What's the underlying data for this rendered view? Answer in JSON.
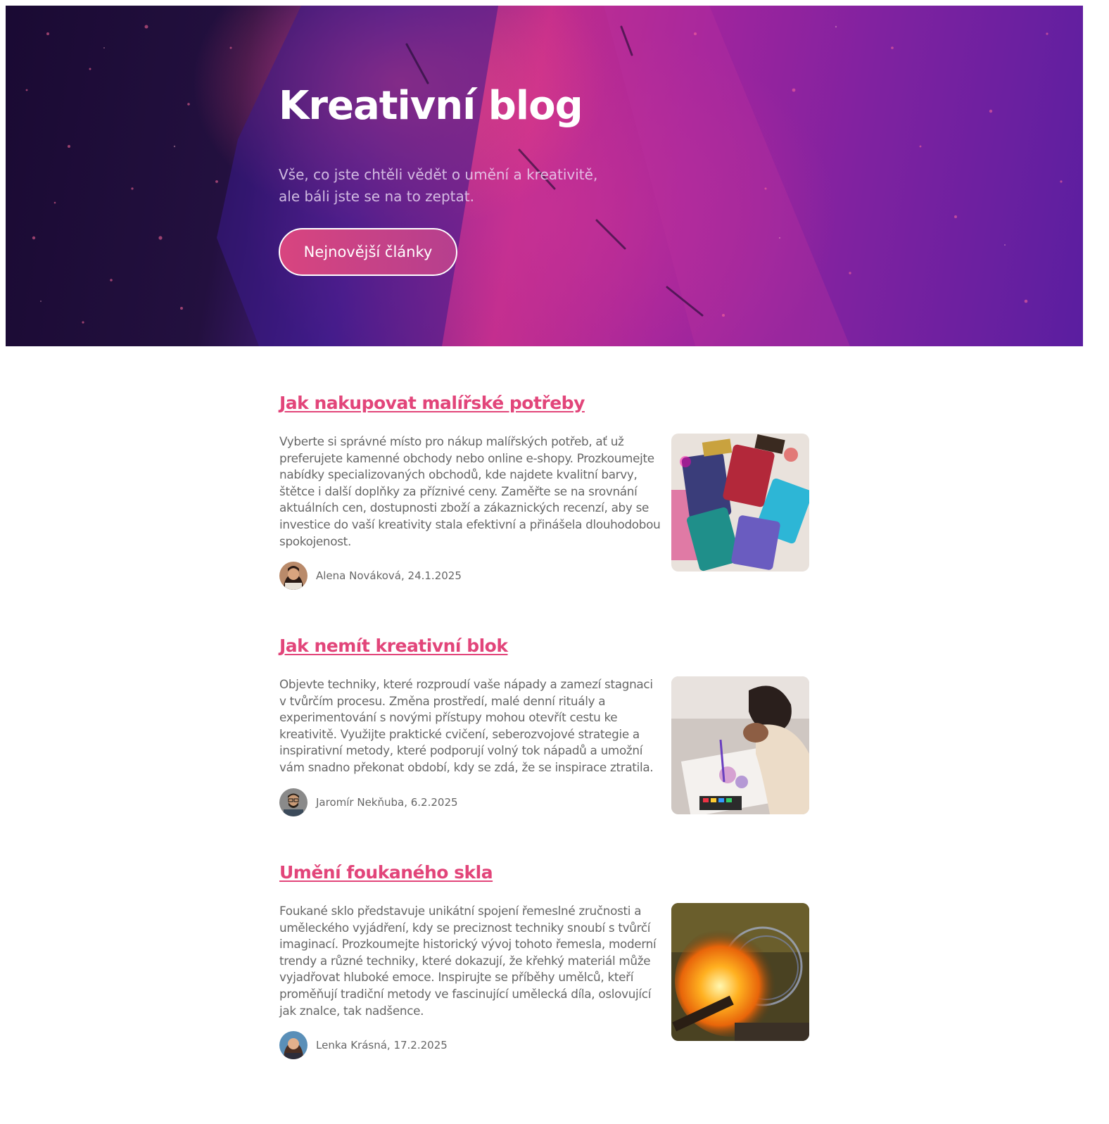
{
  "hero": {
    "title": "Kreativní blog",
    "subtitle": "Vše, co jste chtěli vědět o umění a kreativitě, ale báli jste se na to zeptat.",
    "cta_label": "Nejnovější články"
  },
  "articles": [
    {
      "title": "Jak nakupovat malířské potřeby",
      "text": "Vyberte si správné místo pro nákup malířských potřeb, ať už preferujete kamenné obchody nebo online e-shopy. Prozkoumejte nabídky specializovaných obchodů, kde najdete kvalitní barvy, štětce i další doplňky za příznivé ceny. Zaměřte se na srovnání aktuálních cen, dostupnosti zboží a zákaznických recenzí, aby se investice do vaší kreativity stala efektivní a přinášela dlouhodobou spokojenost.",
      "meta": "Alena Nováková, 24.1.2025",
      "image_icon": "paintbrushes-image"
    },
    {
      "title": "Jak nemít kreativní blok",
      "text": "Objevte techniky, které rozproudí vaše nápady a zamezí stagnaci v tvůrčím procesu. Změna prostředí, malé denní rituály a experimentování s novými přístupy mohou otevřít cestu ke kreativitě. Využijte praktické cvičení, seberozvojové strategie a inspirativní metody, které podporují volný tok nápadů a umožní vám snadno překonat období, kdy se zdá, že se inspirace ztratila.",
      "meta": "Jaromír Nekňuba, 6.2.2025",
      "image_icon": "woman-painting-image"
    },
    {
      "title": "Umění foukaného skla",
      "text": "Foukané sklo představuje unikátní spojení řemeslné zručnosti a uměleckého vyjádření, kdy se preciznost techniky snoubí s tvůrčí imaginací. Prozkoumejte historický vývoj tohoto řemesla, moderní trendy a různé techniky, které dokazují, že křehký materiál může vyjadřovat hluboké emoce. Inspirujte se příběhy umělců, kteří proměňují tradiční metody ve fascinující umělecká díla, oslovující jak znalce, tak nadšence.",
      "meta": "Lenka Krásná, 17.2.2025",
      "image_icon": "glass-blowing-image"
    }
  ],
  "colors": {
    "accent": "#e2457a",
    "text": "#666666",
    "hero_button": "#d8457f"
  }
}
